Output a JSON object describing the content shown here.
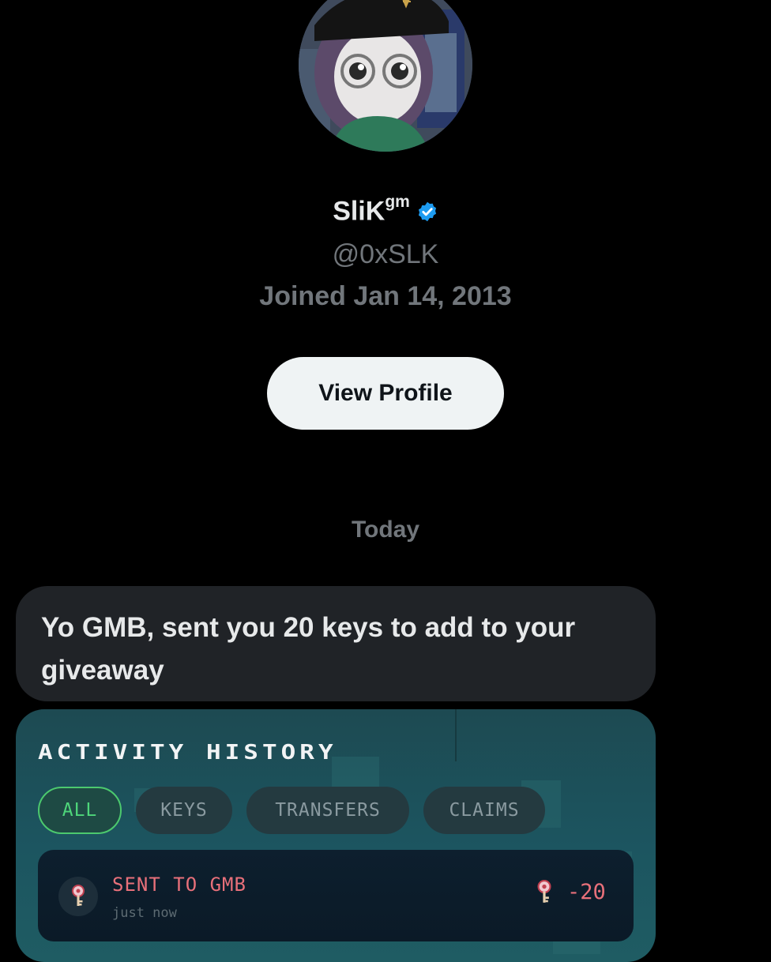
{
  "profile": {
    "display_name": "SliK",
    "name_suffix": "gm",
    "handle": "@0xSLK",
    "joined": "Joined Jan 14, 2013",
    "view_profile_label": "View Profile",
    "verified_icon": "verified-badge-icon",
    "verified_color": "#1d9bf0"
  },
  "conversation": {
    "date_separator": "Today",
    "message_text": "Yo GMB, sent you 20 keys to add to your giveaway"
  },
  "activity_card": {
    "title": "ACTIVITY HISTORY",
    "filters": [
      {
        "label": "ALL",
        "active": true
      },
      {
        "label": "KEYS",
        "active": false
      },
      {
        "label": "TRANSFERS",
        "active": false
      },
      {
        "label": "CLAIMS",
        "active": false
      }
    ],
    "items": [
      {
        "title": "SENT TO GMB",
        "time": "just now",
        "amount": "-20",
        "icon": "key-icon"
      }
    ],
    "colors": {
      "active_filter": "#4ed67a",
      "negative_amount": "#e8707a"
    }
  }
}
